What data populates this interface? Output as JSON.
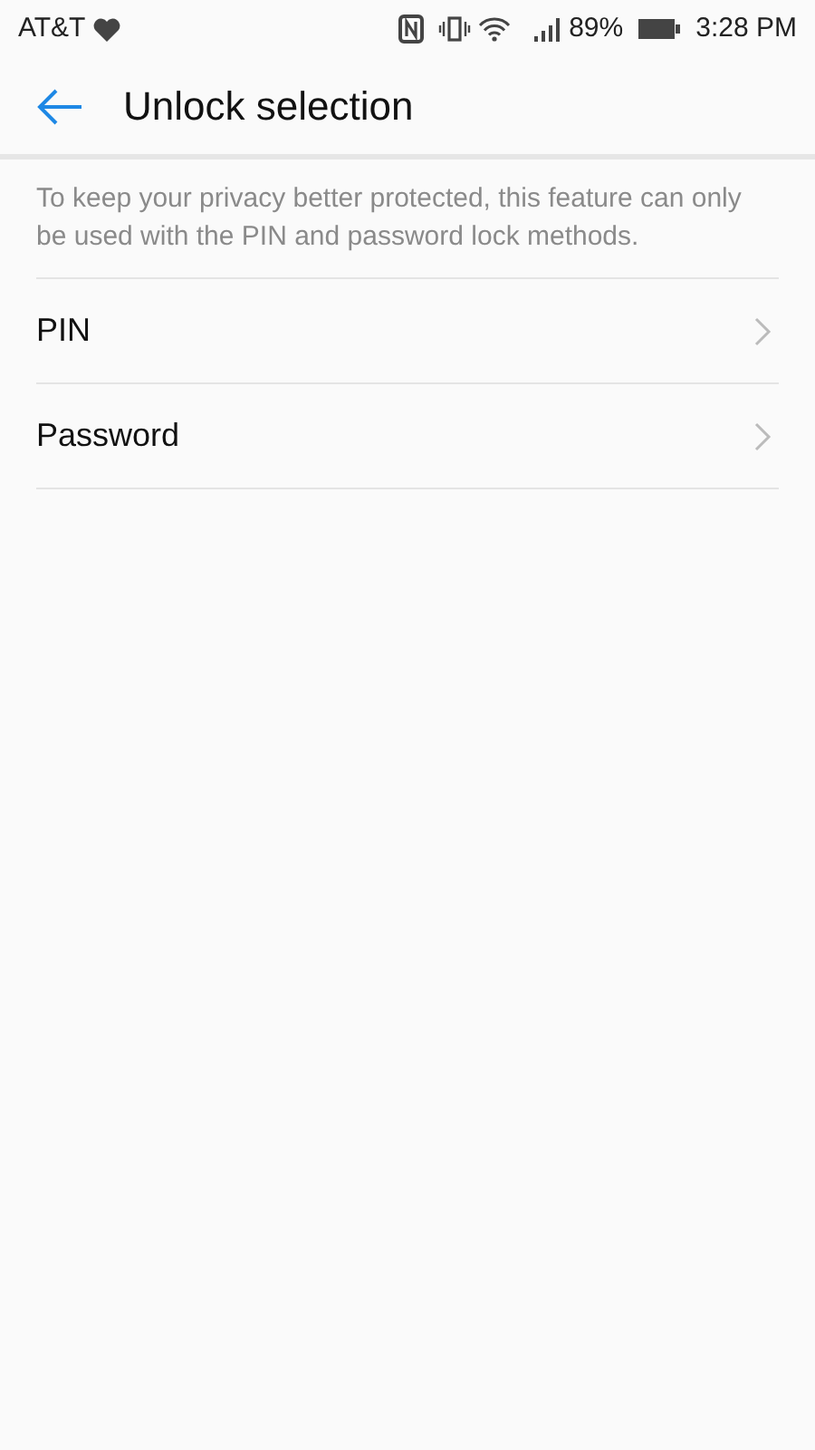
{
  "status_bar": {
    "carrier": "AT&T",
    "battery": "89%",
    "time": "3:28 PM"
  },
  "header": {
    "title": "Unlock selection"
  },
  "description": "To keep your privacy better protected, this feature can only be used with the PIN and password lock methods.",
  "items": [
    {
      "label": "PIN"
    },
    {
      "label": "Password"
    }
  ]
}
